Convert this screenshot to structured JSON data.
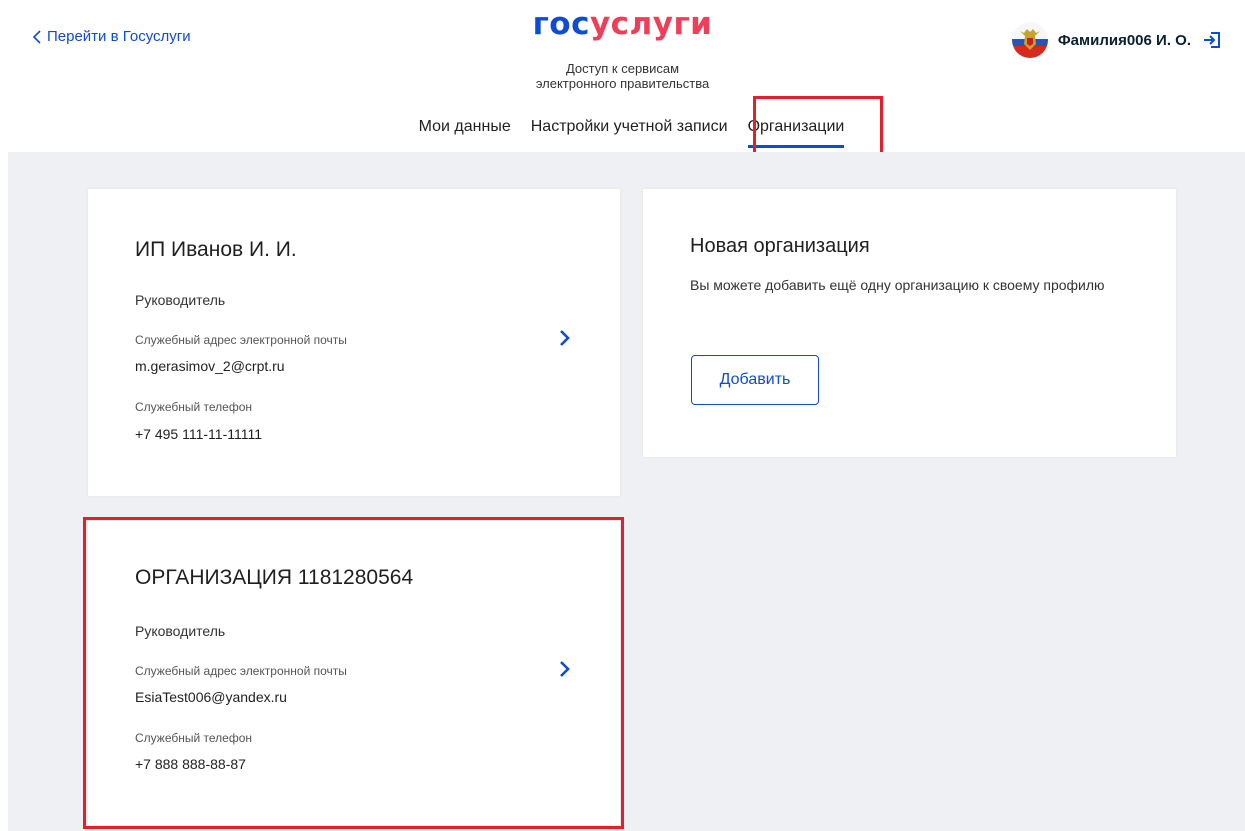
{
  "header": {
    "back_link": "Перейти в Госуслуги",
    "logo_part1": "гос",
    "logo_part2": "услуги",
    "subtitle_line1": "Доступ к сервисам",
    "subtitle_line2": "электронного правительства",
    "user_name": "Фамилия006 И. О."
  },
  "tabs": [
    {
      "label": "Мои данные",
      "active": false
    },
    {
      "label": "Настройки учетной записи",
      "active": false
    },
    {
      "label": "Организации",
      "active": true
    }
  ],
  "organizations": [
    {
      "title": "ИП Иванов И. И.",
      "role": "Руководитель",
      "email_label": "Служебный адрес электронной почты",
      "email": "m.gerasimov_2@crpt.ru",
      "phone_label": "Служебный телефон",
      "phone": "+7 495 111-11-11111"
    },
    {
      "title": "ОРГАНИЗАЦИЯ 1181280564",
      "role": "Руководитель",
      "email_label": "Служебный адрес электронной почты",
      "email": "EsiaTest006@yandex.ru",
      "phone_label": "Служебный телефон",
      "phone": "+7 888 888-88-87"
    }
  ],
  "new_org": {
    "title": "Новая организация",
    "description": "Вы можете добавить ещё одну организацию к своему профилю",
    "button_label": "Добавить"
  },
  "colors": {
    "accent": "#0d4cd3",
    "logo_red": "#ee3f58",
    "highlight": "#e41e2b",
    "background": "#eef0f3"
  }
}
